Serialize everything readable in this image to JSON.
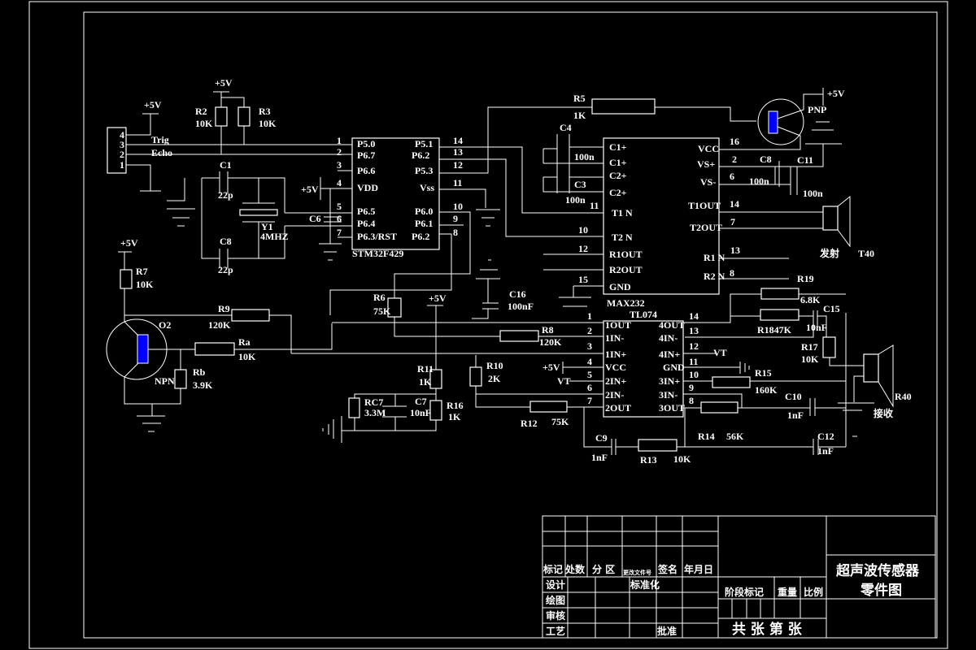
{
  "power_label": "+5V",
  "vt_label": "VT",
  "connector": {
    "pins": [
      "4",
      "3",
      "2",
      "1"
    ],
    "signals": [
      "Trig",
      "Echo"
    ]
  },
  "stm32": {
    "name": "STM32F429",
    "left_pins": [
      "1",
      "2",
      "3",
      "4",
      "5",
      "6",
      "7"
    ],
    "left_labels": [
      "P5.0",
      "P6.7",
      "P6.6",
      "VDD",
      "P6.5",
      "P6.4",
      "P6.3/RST"
    ],
    "right_pins": [
      "14",
      "13",
      "12",
      "11",
      "10",
      "9",
      "8"
    ],
    "right_labels": [
      "P5.1",
      "P6.2",
      "P5.3",
      "Vss",
      "P6.0",
      "P6.1",
      "P6.2"
    ]
  },
  "max232": {
    "name": "MAX232",
    "left_pins": [
      "11",
      "10",
      "12",
      "15"
    ],
    "left_labels": [
      "C1+",
      "C1+",
      "C2+",
      "C2+",
      "T1 N",
      "T2 N",
      "R1OUT",
      "R2OUT",
      "GND"
    ],
    "right_pins": [
      "16",
      "2",
      "6",
      "14",
      "7",
      "13",
      "8"
    ],
    "right_labels": [
      "VCC",
      "VS+",
      "VS-",
      "T1OUT",
      "T2OUT",
      "R1 N",
      "R2 N"
    ]
  },
  "tl074": {
    "name": "TL074",
    "left_pins": [
      "1",
      "2",
      "3",
      "4",
      "5",
      "6",
      "7"
    ],
    "left_labels": [
      "1OUT",
      "1IN-",
      "1IN+",
      "VCC",
      "2IN+",
      "2IN-",
      "2OUT"
    ],
    "right_pins": [
      "14",
      "13",
      "12",
      "11",
      "10",
      "9",
      "8"
    ],
    "right_labels": [
      "4OUT",
      "4IN-",
      "4IN+",
      "GND",
      "3IN+",
      "3IN-",
      "3OUT"
    ]
  },
  "parts": {
    "R2": {
      "ref": "R2",
      "value": "10K"
    },
    "R3": {
      "ref": "R3",
      "value": "10K"
    },
    "R5": {
      "ref": "R5",
      "value": "1K"
    },
    "R6": {
      "ref": "R6",
      "value": "75K"
    },
    "R7": {
      "ref": "R7",
      "value": "10K"
    },
    "R8": {
      "ref": "R8",
      "value": "120K"
    },
    "R9": {
      "ref": "R9",
      "value": "120K"
    },
    "R10": {
      "ref": "R10",
      "value": "2K"
    },
    "R11": {
      "ref": "R11",
      "value": "1K"
    },
    "R12": {
      "ref": "R12",
      "value": "75K"
    },
    "R13": {
      "ref": "R13",
      "value": "10K"
    },
    "R14": {
      "ref": "R14",
      "value": "56K"
    },
    "R15": {
      "ref": "R15",
      "value": "160K"
    },
    "R16": {
      "ref": "R16",
      "value": "1K"
    },
    "R17": {
      "ref": "R17",
      "value": "10K"
    },
    "R18": {
      "ref": "R1847K"
    },
    "R19": {
      "ref": "R19",
      "value": "6.8K"
    },
    "Ra": {
      "ref": "Ra",
      "value": "10K"
    },
    "Rb": {
      "ref": "Rb",
      "value": "3.9K"
    },
    "RC7": {
      "ref": "RC7",
      "value": "3.3M"
    },
    "C1": {
      "ref": "C1",
      "value": "22p"
    },
    "C8a": {
      "ref": "C8",
      "value": "22p"
    },
    "C3": {
      "ref": "C3",
      "value": "100n"
    },
    "C4": {
      "ref": "C4",
      "value": "100n"
    },
    "C6": {
      "ref": "C6"
    },
    "C8b": {
      "ref": "C8",
      "value": "100n"
    },
    "C11": {
      "ref": "C11",
      "value": "100n"
    },
    "C16": {
      "ref": "C16",
      "value": "100nF"
    },
    "C7": {
      "ref": "C7",
      "value": "10nF"
    },
    "C15": {
      "ref": "C15",
      "value": "10nF"
    },
    "C9": {
      "ref": "C9",
      "value": "1nF"
    },
    "C10": {
      "ref": "C10",
      "value": "1nF"
    },
    "C12": {
      "ref": "C12",
      "value": "1nF"
    },
    "Y1": {
      "ref": "Y1",
      "value": "4MHZ"
    },
    "PNP": {
      "type": "PNP"
    },
    "NPN": {
      "ref": "O2",
      "type": "NPN"
    }
  },
  "transducers": {
    "tx_label": "发射",
    "tx_ref": "T40",
    "rx_label": "接收",
    "rx_ref": "R40"
  },
  "title_block": {
    "title_line1": "超声波传感器",
    "title_line2": "零件图",
    "mark": "标记",
    "count": "处数",
    "zone": "分 区",
    "change_doc": "更改文件号",
    "signature": "签名",
    "date": "年月日",
    "design": "设计",
    "standardize": "标准化",
    "drawing": "绘图",
    "review": "审核",
    "process": "工艺",
    "approve": "批准",
    "stage_mark": "阶段标记",
    "weight": "重量",
    "scale": "比例",
    "sheets": "共 张 第 张"
  }
}
